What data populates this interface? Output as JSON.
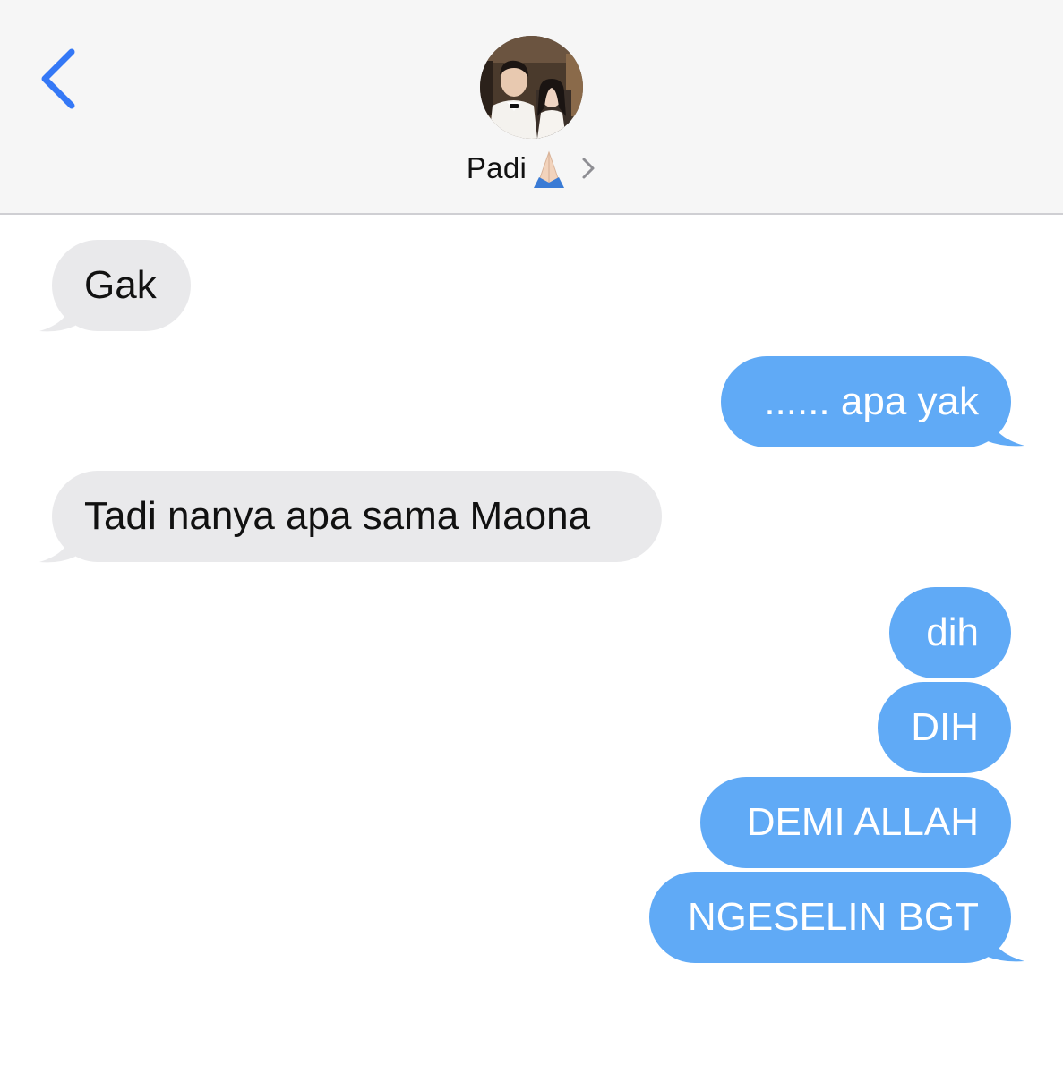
{
  "header": {
    "contact_name": "Padi",
    "contact_emoji": "folded-hands-emoji",
    "back_icon": "chevron-left-icon",
    "details_icon": "chevron-right-icon",
    "accent_color": "#3478f6"
  },
  "messages": [
    {
      "direction": "received",
      "text": "Gak"
    },
    {
      "direction": "sent",
      "text": "...... apa yak"
    },
    {
      "direction": "received",
      "text": "Tadi nanya apa sama Maona"
    },
    {
      "direction": "sent",
      "text": "dih"
    },
    {
      "direction": "sent",
      "text": "DIH"
    },
    {
      "direction": "sent",
      "text": "DEMI ALLAH"
    },
    {
      "direction": "sent",
      "text": "NGESELIN BGT"
    }
  ],
  "colors": {
    "sent_bubble": "#60aaf6",
    "received_bubble": "#e9e9eb",
    "header_background": "#f6f6f6"
  }
}
